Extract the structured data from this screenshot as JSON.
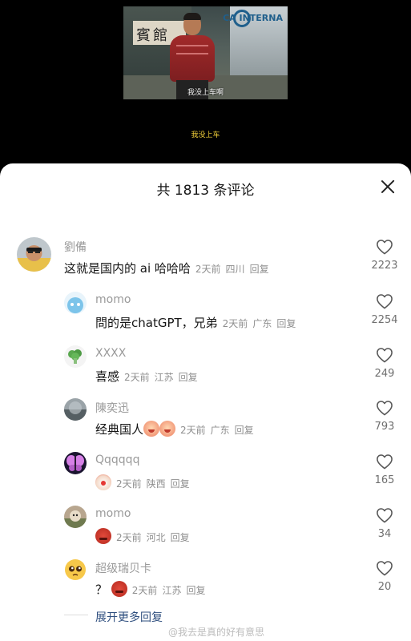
{
  "video": {
    "frame_caption": "我没上车啊",
    "subtitle": "我没上车",
    "sign_text": "賓館",
    "bus_text": "CA INTERNA"
  },
  "sheet": {
    "title": "共 1813 条评论"
  },
  "comments": [
    {
      "name": "劉備",
      "text": "这就是国内的 ai 哈哈哈",
      "time": "2天前",
      "location": "四川",
      "reply": "回复",
      "likes": "2223",
      "avatar": "avatar-photo-man"
    },
    {
      "name": "momo",
      "text": "問的是chatGPT，兄弟",
      "time": "2天前",
      "location": "广东",
      "reply": "回复",
      "likes": "2254",
      "avatar": "avatar-cartoon-blue"
    },
    {
      "name": "XXXX",
      "text": "喜感",
      "time": "2天前",
      "location": "江苏",
      "reply": "回复",
      "likes": "249",
      "avatar": "avatar-broccoli"
    },
    {
      "name": "陳奕迅",
      "text": "经典国人",
      "time": "2天前",
      "location": "广东",
      "reply": "回复",
      "likes": "793",
      "avatar": "avatar-landscape",
      "emoji": "crying-laugh-emoji"
    },
    {
      "name": "Qqqqqq",
      "text": "",
      "time": "2天前",
      "location": "陕西",
      "reply": "回复",
      "likes": "165",
      "avatar": "avatar-butterfly",
      "emoji": "clown-emoji"
    },
    {
      "name": "momo",
      "text": "",
      "time": "2天前",
      "location": "河北",
      "reply": "回复",
      "likes": "34",
      "avatar": "avatar-photo-dog",
      "emoji": "angry-emoji"
    },
    {
      "name": "超级瑞贝卡",
      "text": "？",
      "time": "2天前",
      "location": "江苏",
      "reply": "回复",
      "likes": "20",
      "avatar": "avatar-pleading-emoji",
      "emoji": "angry-emoji"
    }
  ],
  "more_replies": "展开更多回复",
  "watermark": "@我去是真的好有意思",
  "colors": {
    "like_count": "#6f6f6f",
    "link": "#2f4f7f",
    "name": "#9a9a9a"
  }
}
